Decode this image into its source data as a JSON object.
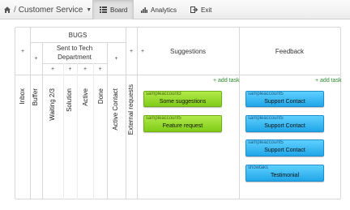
{
  "nav": {
    "project_title": "Customer Service",
    "separator": "/",
    "tabs": [
      {
        "label": "Board",
        "icon": "board-icon",
        "active": true
      },
      {
        "label": "Analytics",
        "icon": "bar-chart-icon",
        "active": false
      },
      {
        "label": "Exit",
        "icon": "exit-icon",
        "active": false
      }
    ]
  },
  "board": {
    "plus": "+",
    "bugs_header": "BUGS",
    "sent_header": "Sent to Tech Department",
    "suggestions_header": "Suggestions",
    "feedback_header": "Feedback",
    "columns": {
      "inbox": "Inbox",
      "buffer": "Buffer",
      "waiting": "Waiting  2/3",
      "solution": "Solution",
      "active": "Active",
      "done": "Done",
      "active_contact": "Active Contact",
      "external_requests": "External requests"
    },
    "add_task_label": "+ add task",
    "suggestions_cards": [
      {
        "owner": "sampleaccount3",
        "title": "Some suggestions"
      },
      {
        "owner": "sampleaccount5",
        "title": "Feature request"
      }
    ],
    "feedback_cards": [
      {
        "owner": "sampleaccount5",
        "title": "Support Contact"
      },
      {
        "owner": "sampleaccount5",
        "title": "Support Contact"
      },
      {
        "owner": "sampleaccount5",
        "title": "Support Contact"
      },
      {
        "owner": "showtaks",
        "title": "Testimonial"
      }
    ]
  },
  "colors": {
    "green_card": "#8fd62a",
    "blue_card": "#2fb4f0",
    "add_task": "#2a8a2a"
  }
}
